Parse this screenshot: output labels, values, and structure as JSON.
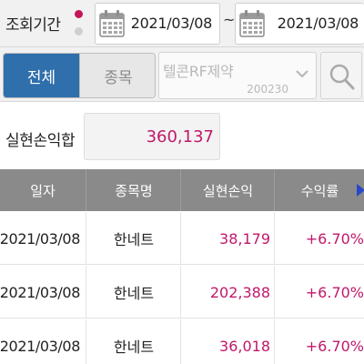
{
  "period": {
    "label": "조회기간",
    "start_date": "2021/03/08",
    "separator": "~",
    "end_date": "2021/03/08"
  },
  "filter": {
    "tabs": [
      {
        "label": "전체",
        "selected": true
      },
      {
        "label": "종목",
        "selected": false
      }
    ],
    "stock_name": "텔콘RF제약",
    "stock_code": "200230"
  },
  "summary": {
    "label": "실현손익합",
    "value": "360,137"
  },
  "table": {
    "headers": [
      "일자",
      "종목명",
      "실현손익",
      "수익률"
    ],
    "rows": [
      {
        "date": "2021/03/08",
        "name": "한네트",
        "profit": "38,179",
        "rate": "+6.70%"
      },
      {
        "date": "2021/03/08",
        "name": "한네트",
        "profit": "202,388",
        "rate": "+6.70%"
      },
      {
        "date": "2021/03/08",
        "name": "한네트",
        "profit": "36,018",
        "rate": "+6.70%"
      }
    ]
  },
  "colors": {
    "accent_blue": "#2f6fab",
    "profit_magenta": "#c0186a",
    "header_gray": "#8a8a8a"
  }
}
